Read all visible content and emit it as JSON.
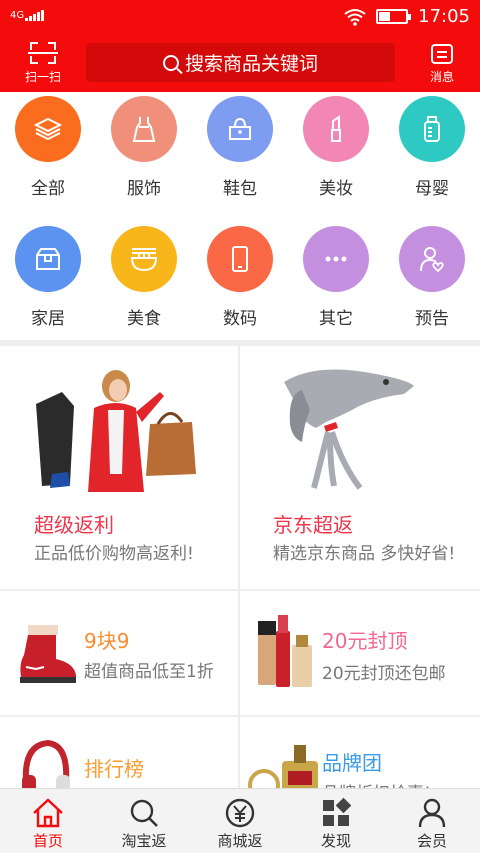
{
  "status_bar": {
    "network": "4G",
    "time": "17:05"
  },
  "header": {
    "scan_label": "扫一扫",
    "search_placeholder": "搜索商品关键词",
    "message_label": "消息"
  },
  "categories": [
    {
      "label": "全部",
      "icon": "layers-icon",
      "color": "#fa6d1e"
    },
    {
      "label": "服饰",
      "icon": "dress-icon",
      "color": "#f0907a"
    },
    {
      "label": "鞋包",
      "icon": "handbag-icon",
      "color": "#7e9cf0"
    },
    {
      "label": "美妆",
      "icon": "lipstick-icon",
      "color": "#f286b4"
    },
    {
      "label": "母婴",
      "icon": "baby-bottle-icon",
      "color": "#2fc9c4"
    },
    {
      "label": "家居",
      "icon": "box-icon",
      "color": "#5c93f0"
    },
    {
      "label": "美食",
      "icon": "noodle-bowl-icon",
      "color": "#f9b61a"
    },
    {
      "label": "数码",
      "icon": "phone-icon",
      "color": "#fa6846"
    },
    {
      "label": "其它",
      "icon": "more-icon",
      "color": "#c58fdf"
    },
    {
      "label": "预告",
      "icon": "person-heart-icon",
      "color": "#c58fdf"
    }
  ],
  "promos": {
    "super_rebate": {
      "title": "超级返利",
      "subtitle": "正品低价购物高返利!",
      "title_color": "#f0344a"
    },
    "jd_rebate": {
      "title": "京东超返",
      "subtitle": "精选京东商品 多快好省!",
      "title_color": "#f0344a"
    },
    "nine_yuan": {
      "title": "9块9",
      "subtitle": "超值商品低至1折",
      "title_color": "#fa8c2e"
    },
    "twenty_yuan": {
      "title": "20元封顶",
      "subtitle": "20元封顶还包邮",
      "title_color": "#f2678f"
    },
    "ranking": {
      "title": "排行榜",
      "subtitle": "",
      "title_color": "#fa9c2e"
    },
    "brand_group": {
      "title": "品牌团",
      "subtitle": "品牌折扣抢惠!",
      "title_color": "#3a9be8"
    }
  },
  "bottom_nav": [
    {
      "label": "首页",
      "icon": "home-icon",
      "active": true
    },
    {
      "label": "淘宝返",
      "icon": "search-icon",
      "active": false
    },
    {
      "label": "商城返",
      "icon": "yen-coin-icon",
      "active": false
    },
    {
      "label": "发现",
      "icon": "discover-grid-icon",
      "active": false
    },
    {
      "label": "会员",
      "icon": "user-icon",
      "active": false
    }
  ]
}
